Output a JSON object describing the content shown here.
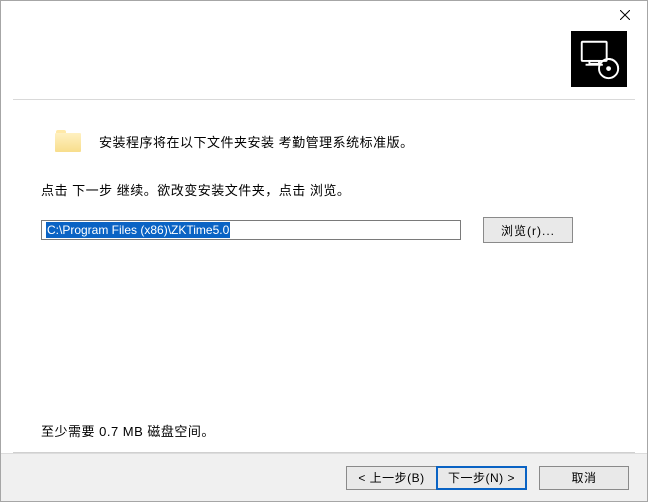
{
  "titlebar": {
    "close_tooltip": "Close"
  },
  "content": {
    "intro": "安装程序将在以下文件夹安装 考勤管理系统标准版。",
    "instruction": "点击 下一步 继续。欲改变安装文件夹，点击 浏览。",
    "path_value": "C:\\Program Files (x86)\\ZKTime5.0",
    "browse_label": "浏览(r)...",
    "disk_space": "至少需要 0.7 MB 磁盘空间。"
  },
  "footer": {
    "back_label": "< 上一步(B)",
    "next_label": "下一步(N) >",
    "cancel_label": "取消"
  },
  "colors": {
    "selection_bg": "#0a63c4",
    "primary_border": "#0a63c4"
  }
}
